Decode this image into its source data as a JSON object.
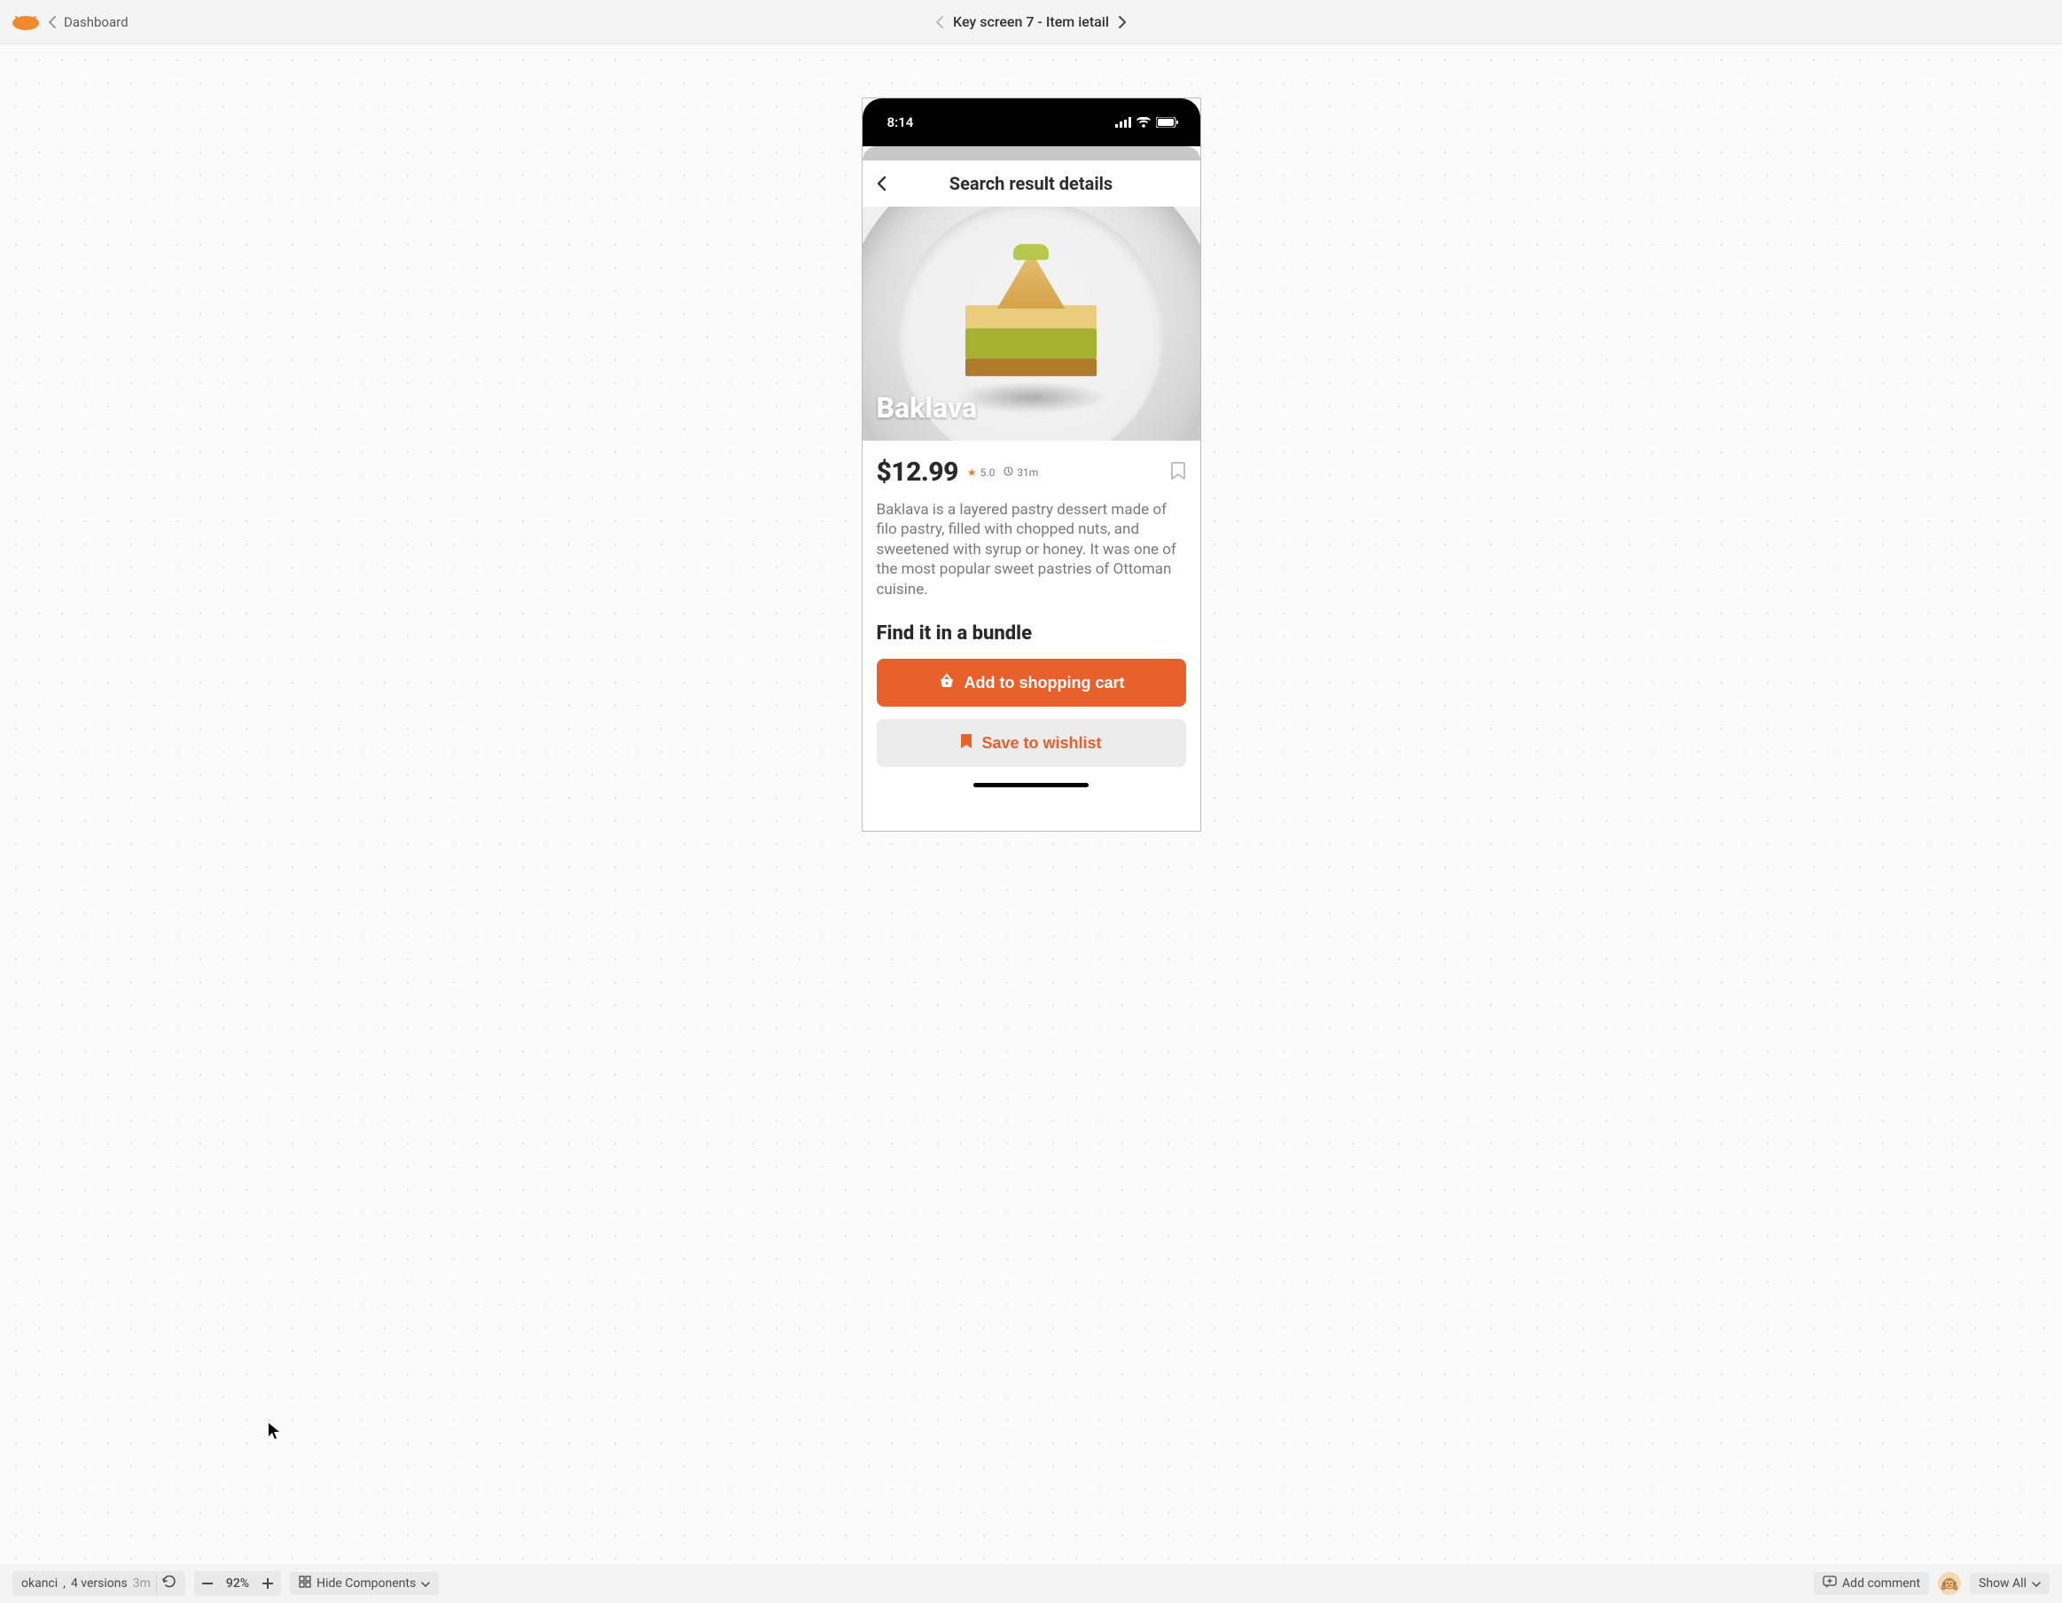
{
  "topbar": {
    "breadcrumb": "Dashboard",
    "page_title": "Key screen 7 - Item ietail"
  },
  "phone": {
    "time": "8:14",
    "header_title": "Search result details",
    "hero_title": "Baklava",
    "price": "$12.99",
    "rating": "5.0",
    "prep_time": "31m",
    "description": "Baklava is a layered pastry dessert made of filo pastry, filled with chopped nuts, and sweetened with syrup or honey. It was one of the most popular sweet pastries of Ottoman cuisine.",
    "bundle_heading": "Find it in a bundle",
    "cta_primary": "Add to shopping cart",
    "cta_secondary": "Save to wishlist"
  },
  "bottombar": {
    "user": "okanci",
    "versions": "4 versions",
    "age": "3m",
    "zoom": "92%",
    "hide_components": "Hide Components",
    "add_comment": "Add comment",
    "show_all": "Show All",
    "avatar_emoji": "🙉"
  }
}
